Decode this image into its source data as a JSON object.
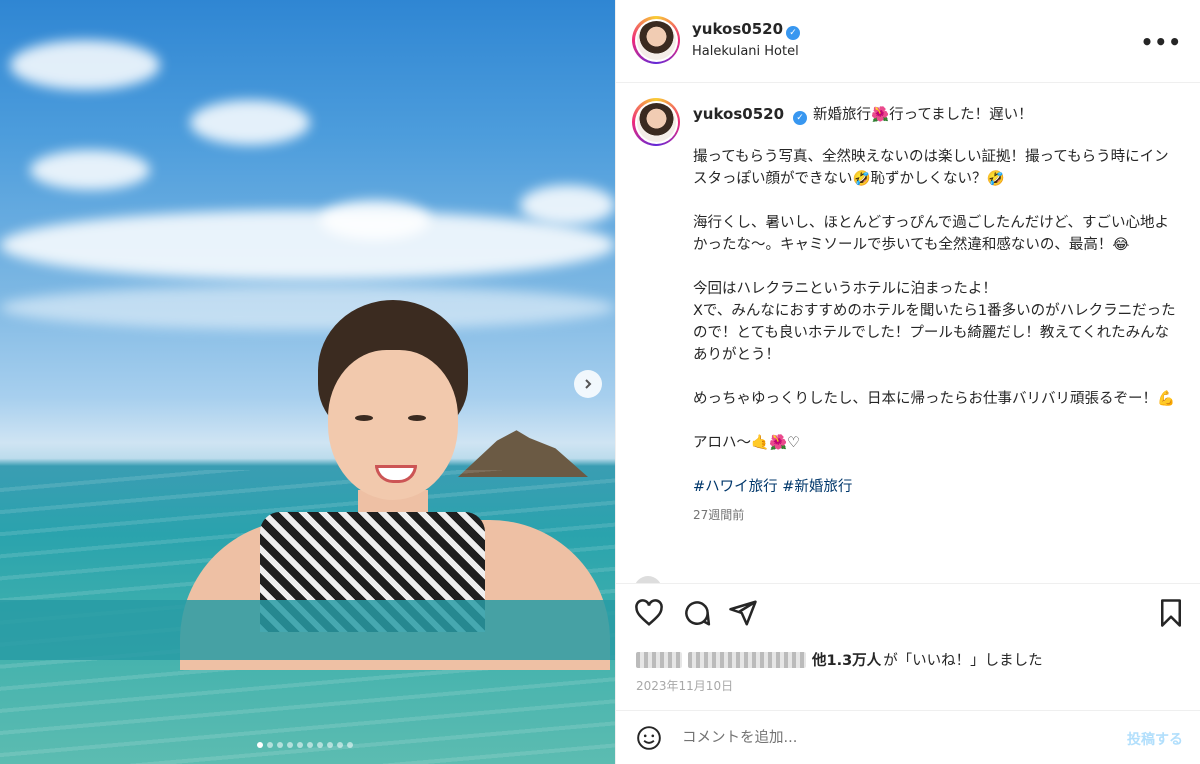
{
  "post": {
    "username": "yukos0520",
    "location": "Halekulani Hotel",
    "verified_badge": "✓",
    "more_label": "•••"
  },
  "caption": {
    "username": "yukos0520",
    "paragraphs": [
      "新婚旅行🌺行ってました！遅い！",
      "撮ってもらう写真、全然映えないのは楽しい証拠！撮ってもらう時にインスタっぽい顔ができない🤣恥ずかしくない？🤣",
      "海行くし、暑いし、ほとんどすっぴんで過ごしたんだけど、すごい心地よかったな〜。キャミソールで歩いても全然違和感ないの、最高！😂",
      "今回はハレクラニというホテルに泊まったよ！\nXで、みんなにおすすめのホテルを聞いたら1番多いのがハレクラニだったので！とても良いホテルでした！プールも綺麗だし！教えてくれたみんなありがとう！",
      "めっちゃゆっくりしたし、日本に帰ったらお仕事バリバリ頑張るぞー！💪",
      "アロハ〜🤙🌺♡"
    ],
    "hashtags": "#ハワイ旅行 #新婚旅行",
    "time_ago": "27週間前"
  },
  "likes": {
    "count_text": "他1.3万人",
    "suffix_text": "が「いいね！」しました"
  },
  "date": "2023年11月10日",
  "comment": {
    "placeholder": "コメントを追加...",
    "post_label": "投稿する"
  },
  "carousel": {
    "total": 10,
    "active_index": 0
  },
  "colors": {
    "link": "#00376b",
    "verified": "#3897f0",
    "post_disabled": "#b2dffc"
  }
}
